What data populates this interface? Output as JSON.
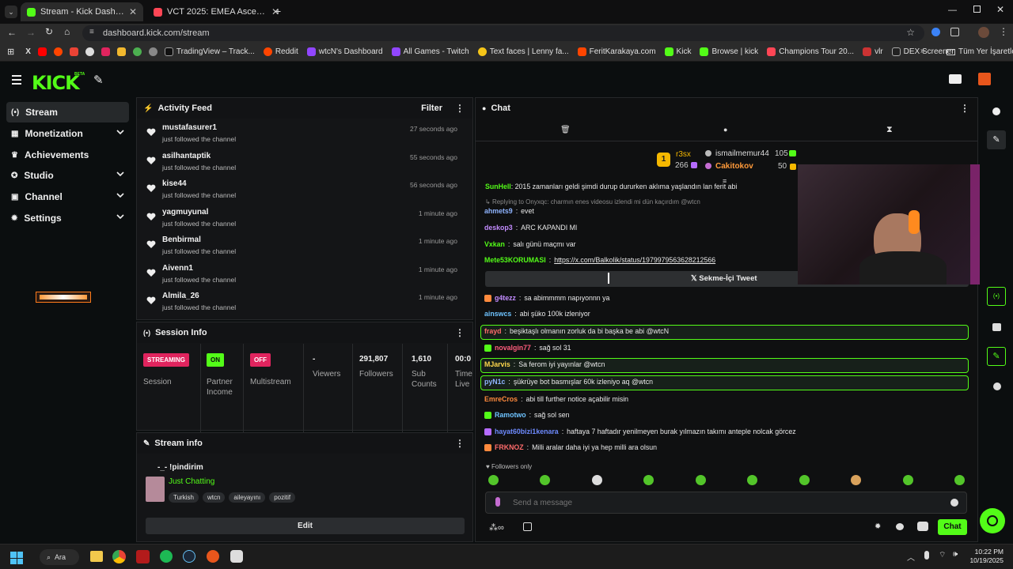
{
  "browser": {
    "tabs": [
      {
        "title": "Stream - Kick Dashboard",
        "active": true
      },
      {
        "title": "VCT 2025: EMEA Ascension: Br...",
        "active": false
      }
    ],
    "url": "dashboard.kick.com/stream",
    "bookmarks": [
      "TradingView – Track...",
      "Reddit",
      "wtcN's Dashboard",
      "All Games - Twitch",
      "Text faces | Lenny fa...",
      "FeritKarakaya.com",
      "Kick",
      "Browse | kick",
      "Champions Tour 20...",
      "vlr",
      "DEX Screener"
    ],
    "bookmarks_more": "Tüm Yer İşaretleri"
  },
  "kick": {
    "logo": "KICK",
    "logo_tag": "BETA",
    "sidebar": [
      {
        "label": "Stream",
        "icon": "broadcast-icon",
        "active": true,
        "chevron": false
      },
      {
        "label": "Monetization",
        "icon": "dollar-icon",
        "active": false,
        "chevron": true
      },
      {
        "label": "Achievements",
        "icon": "trophy-icon",
        "active": false,
        "chevron": false
      },
      {
        "label": "Studio",
        "icon": "studio-icon",
        "active": false,
        "chevron": true
      },
      {
        "label": "Channel",
        "icon": "channel-icon",
        "active": false,
        "chevron": true
      },
      {
        "label": "Settings",
        "icon": "gear-icon",
        "active": false,
        "chevron": true
      }
    ]
  },
  "activity": {
    "title": "Activity Feed",
    "filter": "Filter",
    "items": [
      {
        "name": "mustafasurer1",
        "action": "just followed the channel",
        "time": "27 seconds ago"
      },
      {
        "name": "asilhantaptik",
        "action": "just followed the channel",
        "time": "55 seconds ago"
      },
      {
        "name": "kise44",
        "action": "just followed the channel",
        "time": "56 seconds ago"
      },
      {
        "name": "yagmuyunal",
        "action": "just followed the channel",
        "time": "1 minute ago"
      },
      {
        "name": "Benbirmal",
        "action": "just followed the channel",
        "time": "1 minute ago"
      },
      {
        "name": "Aivenn1",
        "action": "just followed the channel",
        "time": "1 minute ago"
      },
      {
        "name": "Almila_26",
        "action": "just followed the channel",
        "time": "1 minute ago"
      }
    ]
  },
  "session": {
    "title": "Session Info",
    "streaming_badge": "STREAMING",
    "session_label": "Session",
    "partner_badge": "ON",
    "partner_label": "Partner Income",
    "multi_badge": "OFF",
    "multi_label": "Multistream",
    "viewers_val": "-",
    "viewers_label": "Viewers",
    "followers_val": "291,807",
    "followers_label": "Followers",
    "subs_val": "1,610",
    "subs_label": "Sub Counts",
    "time_val": "00:0",
    "time_label": "Time Live"
  },
  "stream_info": {
    "title": "Stream info",
    "stream_title": "-_- !pindirim",
    "category": "Just Chatting",
    "tags": [
      "Turkish",
      "wtcn",
      "aileyayını",
      "pozitif"
    ],
    "edit": "Edit"
  },
  "chat": {
    "title": "Chat",
    "leaders": [
      {
        "rank": "1",
        "name": "r3sx",
        "count": "266"
      },
      {
        "rank": "",
        "name": "ismailmemur44",
        "count": "105"
      },
      {
        "rank": "",
        "name": "Cakitokov",
        "count": "50"
      }
    ],
    "top_line": {
      "user": "SunHell",
      "text": "2015 zamanları geldi şimdi durup dururken aklıma yaşlandın lan ferit abi"
    },
    "reply_note": "Replying to Onyxqc: charmın enes videosu izlendi mi dün kaçırdım @wtcn",
    "messages": [
      {
        "user": "ahmets9",
        "text": "evet",
        "color": "#8fb4ff"
      },
      {
        "user": "deskop3",
        "text": "ARC KAPANDI MI",
        "color": "#c38cff"
      },
      {
        "user": "Vxkan",
        "text": "salı günü maçmı var",
        "color": "#53fc18"
      },
      {
        "user": "Mete53KORUMASI",
        "text": "https://x.com/Balkolik/status/1979979563628212566",
        "color": "#53fc18"
      },
      {
        "user": "g4tezz",
        "text": "sa abimmmm napıyonnn ya",
        "color": "#c38cff"
      },
      {
        "user": "ainswcs",
        "text": "abi şüko 100k izleniyor",
        "color": "#6ec3ff"
      },
      {
        "user": "frayd",
        "text": "beşiktaşlı olmanın zorluk da bi başka be abi @wtcN",
        "color": "#ff6b6b"
      },
      {
        "user": "novalgin77",
        "text": "sağ sol 31",
        "color": "#ff5d7d"
      },
      {
        "user": "MJarvis",
        "text": "Sa ferom iyi yayınlar @wtcn",
        "color": "#ffd84d"
      },
      {
        "user": "pyN1c",
        "text": "şükrüye bot basmışlar 60k izleniyo aq @wtcn",
        "color": "#8fb4ff"
      },
      {
        "user": "EmreCros",
        "text": "abi till further notice açabilir misin",
        "color": "#ff8a3d"
      },
      {
        "user": "Ramotwo",
        "text": "sağ sol sen",
        "color": "#6ec3ff"
      },
      {
        "user": "hayat60bizi1kenara",
        "text": "haftaya 7 haftadır yenilmeyen burak yılmazın takımı anteple nolcak görcez",
        "color": "#6e8bff"
      },
      {
        "user": "FRKNOZ",
        "text": "Milli aralar daha iyi ya hep milli ara olsun",
        "color": "#ff6b6b"
      }
    ],
    "tweet_embed": "Sekme-İçi Tweet",
    "followers_only": "Followers only",
    "placeholder": "Send a message",
    "chat_button": "Chat"
  },
  "taskbar": {
    "search": "Ara",
    "time": "10:22 PM",
    "date": "10/19/2025"
  },
  "colors": {
    "accent": "#53fc18",
    "streaming": "#e0245e"
  }
}
